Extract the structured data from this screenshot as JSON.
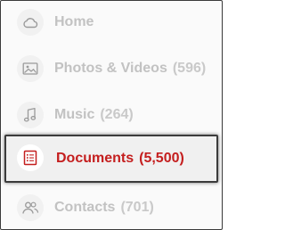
{
  "nav": {
    "items": [
      {
        "label": "Home",
        "count": "",
        "icon": "cloud-icon",
        "active": false
      },
      {
        "label": "Photos & Videos",
        "count": "(596)",
        "icon": "photo-icon",
        "active": false
      },
      {
        "label": "Music",
        "count": "(264)",
        "icon": "music-note-icon",
        "active": false
      },
      {
        "label": "Documents",
        "count": "(5,500)",
        "icon": "document-list-icon",
        "active": true
      },
      {
        "label": "Contacts",
        "count": "(701)",
        "icon": "contacts-icon",
        "active": false
      }
    ]
  },
  "colors": {
    "active_accent": "#c41e1e",
    "inactive_text": "#c2c2c2",
    "icon_gray": "#9a9a9a"
  }
}
